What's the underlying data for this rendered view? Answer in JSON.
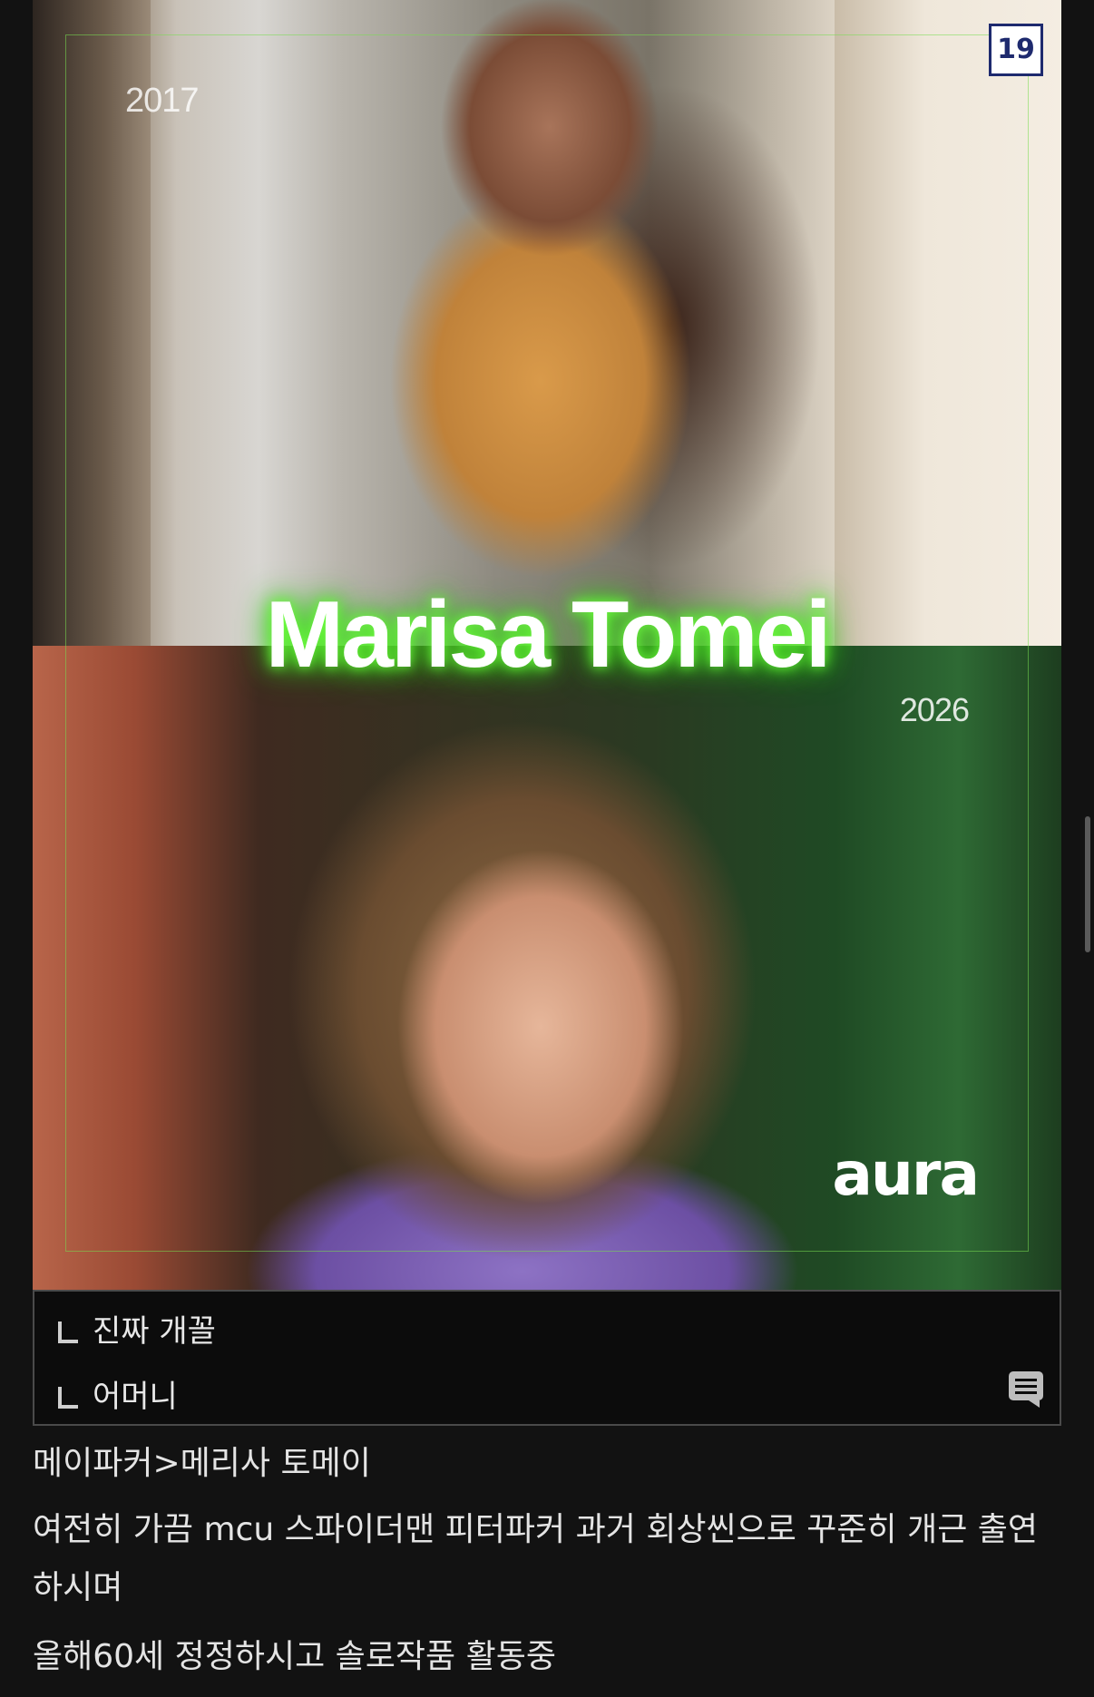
{
  "image": {
    "badge": "19",
    "year_top": "2017",
    "year_bottom": "2026",
    "title": "Marisa Tomei",
    "brand": "aura"
  },
  "comments": [
    {
      "text": "진짜 개꼴"
    },
    {
      "text": "어머니"
    }
  ],
  "icons": {
    "comment": "comment-icon",
    "reply": "reply-arrow-icon"
  },
  "body": {
    "line1": "메이파커>메리사 토메이",
    "line2": "여전히 가끔 mcu 스파이더맨 피터파커 과거 회상씬으로 꾸준히 개근 출연하시며",
    "line3": "올해60세 정정하시고 솔로작품 활동중"
  },
  "colors": {
    "background": "#121212",
    "glow": "#3fdc1f",
    "badge_border": "#1e2a6e"
  }
}
